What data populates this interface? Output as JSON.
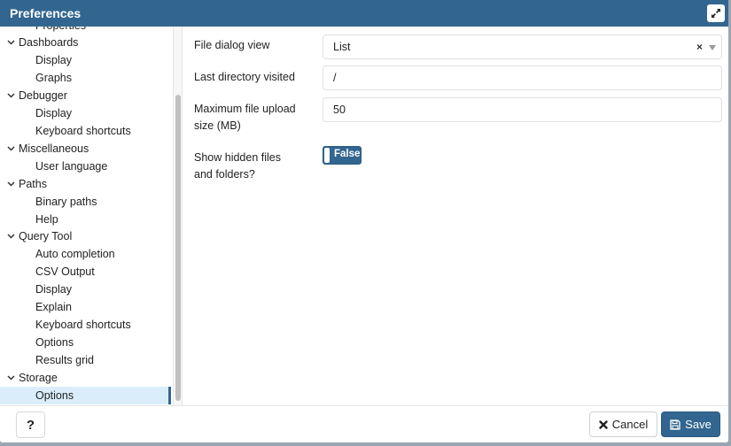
{
  "dialog": {
    "title": "Preferences",
    "expand_icon": "expand-arrows-icon"
  },
  "sidebar": {
    "partial_top_item": "Properties",
    "items": [
      {
        "type": "group",
        "label": "Dashboards"
      },
      {
        "type": "child",
        "label": "Display"
      },
      {
        "type": "child",
        "label": "Graphs"
      },
      {
        "type": "group",
        "label": "Debugger"
      },
      {
        "type": "child",
        "label": "Display"
      },
      {
        "type": "child",
        "label": "Keyboard shortcuts"
      },
      {
        "type": "group",
        "label": "Miscellaneous"
      },
      {
        "type": "child",
        "label": "User language"
      },
      {
        "type": "group",
        "label": "Paths"
      },
      {
        "type": "child",
        "label": "Binary paths"
      },
      {
        "type": "child",
        "label": "Help"
      },
      {
        "type": "group",
        "label": "Query Tool"
      },
      {
        "type": "child",
        "label": "Auto completion"
      },
      {
        "type": "child",
        "label": "CSV Output"
      },
      {
        "type": "child",
        "label": "Display"
      },
      {
        "type": "child",
        "label": "Explain"
      },
      {
        "type": "child",
        "label": "Keyboard shortcuts"
      },
      {
        "type": "child",
        "label": "Options"
      },
      {
        "type": "child",
        "label": "Results grid"
      },
      {
        "type": "group",
        "label": "Storage"
      },
      {
        "type": "child",
        "label": "Options",
        "selected": true
      }
    ]
  },
  "form": {
    "file_dialog_view": {
      "label": "File dialog view",
      "value": "List",
      "clear": "×"
    },
    "last_directory": {
      "label": "Last directory visited",
      "value": "/"
    },
    "max_upload": {
      "label_line1": "Maximum file upload",
      "label_line2": "size (MB)",
      "value": "50"
    },
    "show_hidden": {
      "label_line1": "Show hidden files",
      "label_line2": "and folders?",
      "value": "False"
    }
  },
  "footer": {
    "help_label": "?",
    "cancel_label": "Cancel",
    "save_label": "Save"
  },
  "colors": {
    "brand": "#326690",
    "selected_bg": "#d9eefa"
  }
}
